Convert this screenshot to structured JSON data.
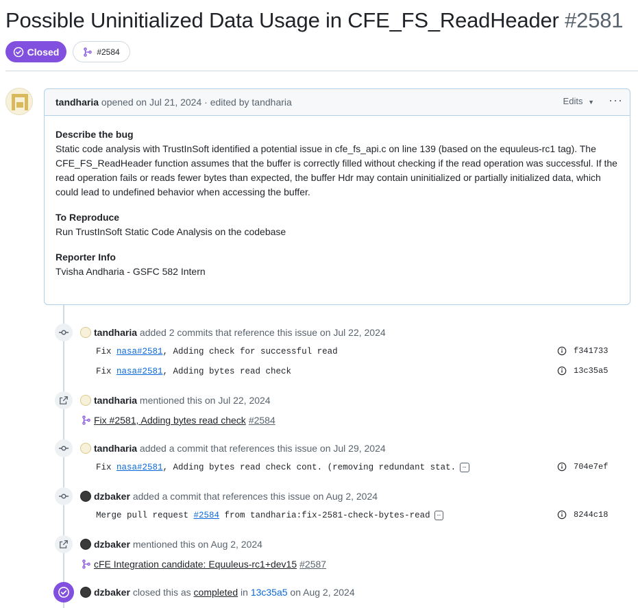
{
  "issue": {
    "title": "Possible Uninitialized Data Usage in CFE_FS_ReadHeader",
    "number": "#2581",
    "status": "Closed",
    "linked_pr": "#2584"
  },
  "comment": {
    "author": "tandharia",
    "meta": "opened on Jul 21, 2024 · edited by tandharia",
    "edits_label": "Edits",
    "sections": [
      {
        "heading": "Describe the bug",
        "text": "Static code analysis with TrustInSoft identified a potential issue in cfe_fs_api.c on line 139 (based on the equuleus-rc1 tag). The CFE_FS_ReadHeader function assumes that the buffer is correctly filled without checking if the read operation was successful. If the read operation fails or reads fewer bytes than expected, the buffer Hdr may contain uninitialized or partially initialized data, which could lead to undefined behavior when accessing the buffer."
      },
      {
        "heading": "To Reproduce",
        "text": "Run TrustInSoft Static Code Analysis on the codebase"
      },
      {
        "heading": "Reporter Info",
        "text": "Tvisha Andharia - GSFC 582 Intern"
      }
    ]
  },
  "timeline": {
    "e1": {
      "actor": "tandharia",
      "text": "added 2 commits that reference this issue on Jul 22, 2024",
      "commits": [
        {
          "prefix": "Fix ",
          "ref": "nasa#2581",
          "rest": ", Adding check for successful read",
          "sha": "f341733"
        },
        {
          "prefix": "Fix ",
          "ref": "nasa#2581",
          "rest": ", Adding bytes read check",
          "sha": "13c35a5"
        }
      ]
    },
    "e2": {
      "actor": "tandharia",
      "text": "mentioned this on Jul 22, 2024",
      "pr_title": "Fix #2581, Adding bytes read check",
      "pr_number": "#2584"
    },
    "e3": {
      "actor": "tandharia",
      "text": "added a commit that references this issue on Jul 29, 2024",
      "commit": {
        "prefix": "Fix ",
        "ref": "nasa#2581",
        "rest": ", Adding bytes read check cont. (removing redundant stat.",
        "sha": "704e7ef"
      }
    },
    "e4": {
      "actor": "dzbaker",
      "text": "added a commit that references this issue on Aug 2, 2024",
      "commit": {
        "prefix": "Merge pull request ",
        "ref": "#2584",
        "rest": " from tandharia:fix-2581-check-bytes-read",
        "sha": "8244c18"
      }
    },
    "e5": {
      "actor": "dzbaker",
      "text": "mentioned this on Aug 2, 2024",
      "pr_title": "cFE Integration candidate: Equuleus-rc1+dev15",
      "pr_number": "#2587"
    },
    "e6": {
      "actor": "dzbaker",
      "pre": "closed this as",
      "completed": "completed",
      "in_word": "in",
      "sha": "13c35a5",
      "date": "on Aug 2, 2024"
    }
  },
  "colors": {
    "accent_purple": "#8250df",
    "link_blue": "#0969da",
    "border_blue": "#afd0e8"
  }
}
